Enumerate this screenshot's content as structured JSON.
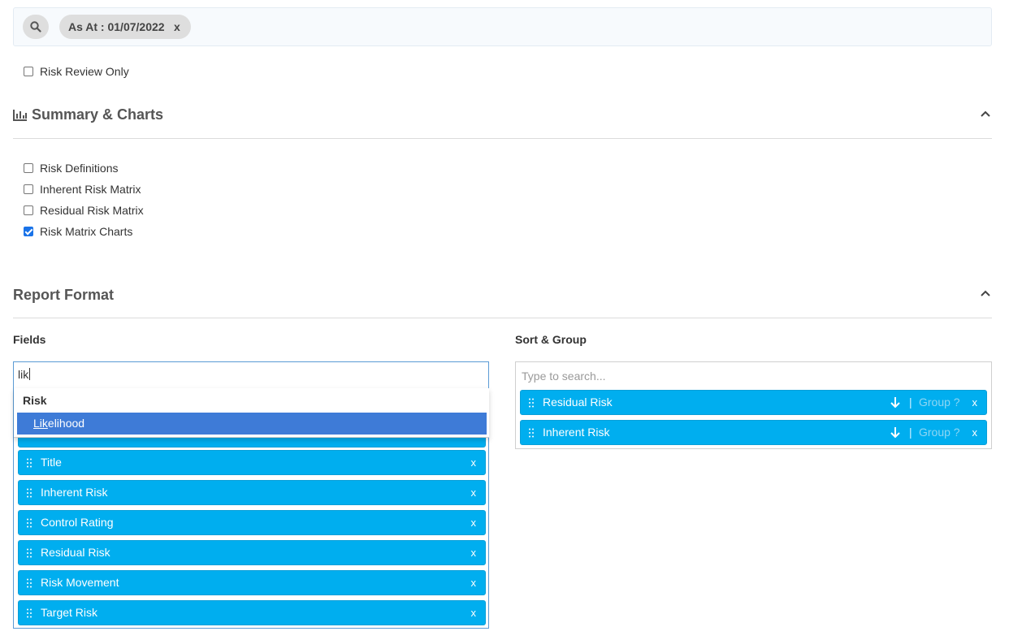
{
  "filter_bar": {
    "chip_label": "As At : 01/07/2022",
    "chip_remove": "x"
  },
  "risk_review_only": {
    "label": "Risk Review Only",
    "checked": false
  },
  "summary_section": {
    "title": "Summary & Charts",
    "options": [
      {
        "label": "Risk Definitions",
        "checked": false
      },
      {
        "label": "Inherent Risk Matrix",
        "checked": false
      },
      {
        "label": "Residual Risk Matrix",
        "checked": false
      },
      {
        "label": "Risk Matrix Charts",
        "checked": true
      }
    ]
  },
  "report_format": {
    "title": "Report Format",
    "fields": {
      "label": "Fields",
      "input_value": "lik",
      "dropdown": {
        "group": "Risk",
        "option_match": "Lik",
        "option_rest": "elihood"
      },
      "items": [
        {
          "label": "Title",
          "remove": "x"
        },
        {
          "label": "Inherent Risk",
          "remove": "x"
        },
        {
          "label": "Control Rating",
          "remove": "x"
        },
        {
          "label": "Residual Risk",
          "remove": "x"
        },
        {
          "label": "Risk Movement",
          "remove": "x"
        },
        {
          "label": "Target Risk",
          "remove": "x"
        }
      ]
    },
    "sort_group": {
      "label": "Sort & Group",
      "placeholder": "Type to search...",
      "items": [
        {
          "label": "Residual Risk",
          "separator": "|",
          "group_label": "Group ?",
          "remove": "x"
        },
        {
          "label": "Inherent Risk",
          "separator": "|",
          "group_label": "Group ?",
          "remove": "x"
        }
      ]
    }
  },
  "colors": {
    "tag_bg": "#00aeef",
    "dropdown_highlight": "#3e7bd7",
    "focus_border": "#5b9bd5",
    "checkbox_checked": "#1a73e8"
  }
}
